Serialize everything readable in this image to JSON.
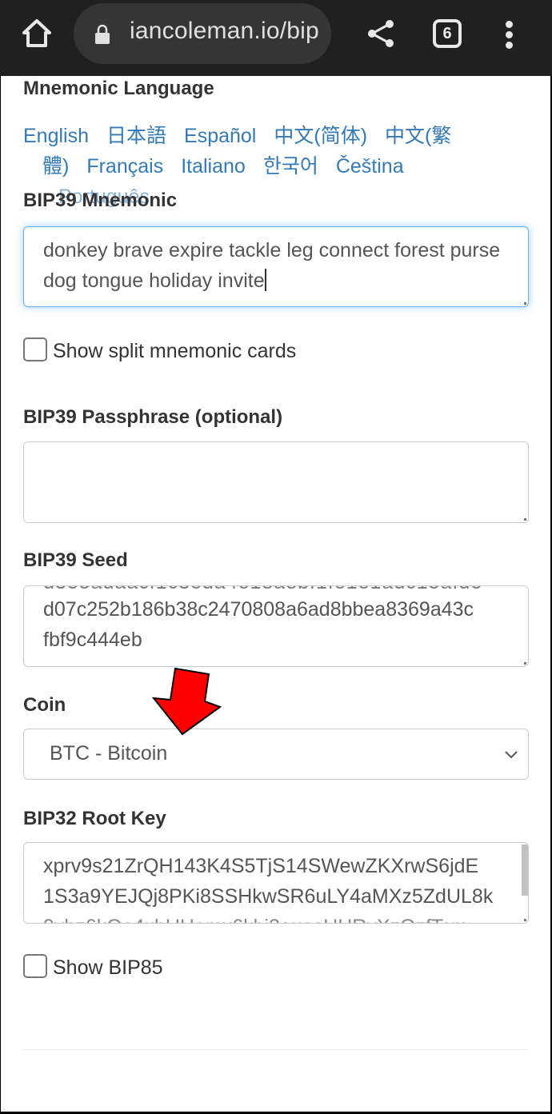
{
  "browser": {
    "url": "iancoleman.io/bip",
    "tab_count": "6",
    "icons": [
      "home-icon",
      "lock-icon",
      "share-icon",
      "tabs-icon",
      "more-menu-icon"
    ]
  },
  "mnemonic_language": {
    "label": "Mnemonic Language",
    "languages": [
      "English",
      "日本語",
      "Español",
      "中文(简体)",
      "中文(繁",
      "體)",
      "Français",
      "Italiano",
      "한국어",
      "Čeština",
      "Português"
    ]
  },
  "bip39_mnemonic": {
    "label": "BIP39 Mnemonic",
    "value": "donkey brave expire tackle leg connect forest purse dog tongue holiday invite"
  },
  "split_cards": {
    "label": "Show split mnemonic cards",
    "checked": false
  },
  "passphrase": {
    "label": "BIP39 Passphrase (optional)",
    "value": ""
  },
  "seed": {
    "label": "BIP39 Seed",
    "visible_lines": [
      "d07c252b186b38c2470808a6ad8bbea8369a43c",
      "fbf9c444eb"
    ]
  },
  "coin": {
    "label": "Coin",
    "selected": "BTC - Bitcoin"
  },
  "root_key": {
    "label": "BIP32 Root Key",
    "visible_lines": [
      "xprv9s21ZrQH143K4S5TjS14SWewZKXrwS6jdE",
      "1S3a9YEJQj8PKi8SSHkwSR6uLY4aMXz5ZdUL8k"
    ]
  },
  "bip85": {
    "label": "Show BIP85",
    "checked": false
  },
  "annotation": {
    "arrow_color": "#ff0000",
    "points_to": "coin-select"
  }
}
